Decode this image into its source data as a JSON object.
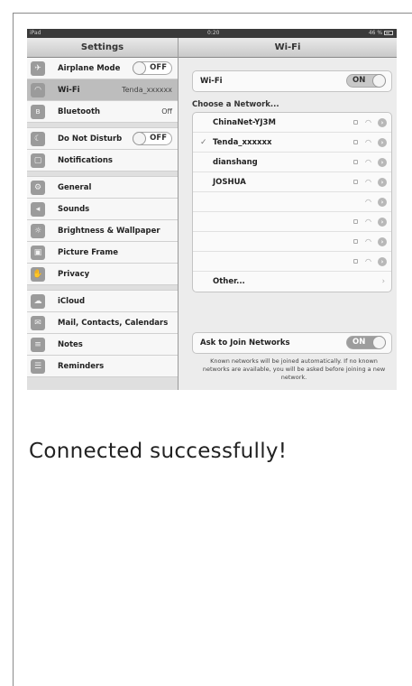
{
  "status_bar": {
    "device": "iPad",
    "time": "0:20",
    "battery": "46 %"
  },
  "settings_panel": {
    "title": "Settings",
    "items": [
      {
        "label": "Airplane Mode",
        "toggle": "OFF",
        "icon": "airplane-icon"
      },
      {
        "label": "Wi-Fi",
        "value": "Tenda_xxxxxx",
        "icon": "wifi-icon"
      },
      {
        "label": "Bluetooth",
        "value": "Off",
        "icon": "bluetooth-icon"
      },
      {
        "label": "Do Not Disturb",
        "toggle": "OFF",
        "icon": "moon-icon"
      },
      {
        "label": "Notifications",
        "icon": "notifications-icon"
      },
      {
        "label": "General",
        "icon": "gear-icon"
      },
      {
        "label": "Sounds",
        "icon": "speaker-icon"
      },
      {
        "label": "Brightness & Wallpaper",
        "icon": "brightness-icon"
      },
      {
        "label": "Picture Frame",
        "icon": "picture-frame-icon"
      },
      {
        "label": "Privacy",
        "icon": "hand-icon"
      },
      {
        "label": "iCloud",
        "icon": "cloud-icon"
      },
      {
        "label": "Mail, Contacts, Calendars",
        "icon": "mail-icon"
      },
      {
        "label": "Notes",
        "icon": "notes-icon"
      },
      {
        "label": "Reminders",
        "icon": "reminders-icon"
      }
    ]
  },
  "wifi_panel": {
    "title": "Wi-Fi",
    "wifi_label": "Wi-Fi",
    "wifi_toggle": "ON",
    "choose_label": "Choose a Network...",
    "networks": [
      {
        "name": "ChinaNet-YJ3M",
        "locked": true
      },
      {
        "name": "Tenda_xxxxxx",
        "locked": true,
        "connected": true,
        "checkmark": "✓"
      },
      {
        "name": "dianshang",
        "locked": true
      },
      {
        "name": "JOSHUA",
        "locked": true
      },
      {
        "name": "",
        "locked": false
      },
      {
        "name": "",
        "locked": true
      },
      {
        "name": "",
        "locked": true
      },
      {
        "name": "",
        "locked": true
      }
    ],
    "other_label": "Other...",
    "ask_label": "Ask to Join Networks",
    "ask_toggle": "ON",
    "footnote": "Known networks will be joined automatically. If no known networks are available, you will be asked before joining a new network."
  },
  "caption": "Connected successfully!"
}
